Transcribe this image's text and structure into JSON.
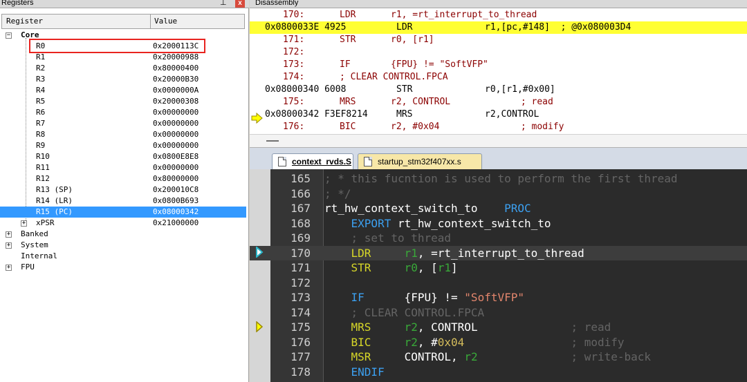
{
  "registers": {
    "title": "Registers",
    "pin_glyph": "⊥",
    "close_glyph": "x",
    "header": {
      "register": "Register",
      "value": "Value"
    },
    "core_label": "Core",
    "rows": [
      {
        "name": "R0",
        "value": "0x2000113C"
      },
      {
        "name": "R1",
        "value": "0x20000988"
      },
      {
        "name": "R2",
        "value": "0x80000400"
      },
      {
        "name": "R3",
        "value": "0x20000B30"
      },
      {
        "name": "R4",
        "value": "0x0000000A"
      },
      {
        "name": "R5",
        "value": "0x20000308"
      },
      {
        "name": "R6",
        "value": "0x00000000"
      },
      {
        "name": "R7",
        "value": "0x00000000"
      },
      {
        "name": "R8",
        "value": "0x00000000"
      },
      {
        "name": "R9",
        "value": "0x00000000"
      },
      {
        "name": "R10",
        "value": "0x0800E8E8"
      },
      {
        "name": "R11",
        "value": "0x00000000"
      },
      {
        "name": "R12",
        "value": "0x80000000"
      },
      {
        "name": "R13 (SP)",
        "value": "0x200010C8"
      },
      {
        "name": "R14 (LR)",
        "value": "0x0800B693"
      },
      {
        "name": "R15 (PC)",
        "value": "0x08000342"
      },
      {
        "name": "xPSR",
        "value": "0x21000000"
      }
    ],
    "groups": [
      "Banked",
      "System",
      "Internal",
      "FPU"
    ]
  },
  "disassembly": {
    "title": "Disassembly",
    "lines": [
      {
        "kind": "src",
        "num": "170:",
        "op": "LDR",
        "args": "r1, =rt_interrupt_to_thread"
      },
      {
        "kind": "cur",
        "addr": "0x0800033E 4925",
        "op": "LDR",
        "args": "r1,[pc,#148]  ; @0x080003D4"
      },
      {
        "kind": "src",
        "num": "171:",
        "op": "STR",
        "args": "r0, [r1]"
      },
      {
        "kind": "src",
        "num": "172:",
        "op": "",
        "args": ""
      },
      {
        "kind": "src",
        "num": "173:",
        "op": "IF",
        "args": "{FPU} != \"SoftVFP\""
      },
      {
        "kind": "src",
        "num": "174:",
        "op": "; CLEAR CONTROL.FPCA",
        "args": ""
      },
      {
        "kind": "asm",
        "addr": "0x08000340 6008",
        "op": "STR",
        "args": "r0,[r1,#0x00]"
      },
      {
        "kind": "src",
        "num": "175:",
        "op": "MRS",
        "args": "r2, CONTROL             ; read"
      },
      {
        "kind": "asm",
        "addr": "0x08000342 F3EF8214",
        "op": "MRS",
        "args": "r2,CONTROL"
      },
      {
        "kind": "src",
        "num": "176:",
        "op": "BIC",
        "args": "r2, #0x04               ; modify"
      }
    ]
  },
  "editor": {
    "tabs": [
      {
        "label": "context_rvds.S",
        "active": true
      },
      {
        "label": "startup_stm32f407xx.s",
        "active": false
      }
    ],
    "lines": [
      {
        "n": "165",
        "cur": false,
        "parts": [
          [
            "c-cm",
            "; * this fucntion is used to perform the first thread"
          ]
        ]
      },
      {
        "n": "166",
        "cur": false,
        "parts": [
          [
            "c-cm",
            "; */"
          ]
        ]
      },
      {
        "n": "167",
        "cur": false,
        "parts": [
          [
            "c-id",
            "rt_hw_context_switch_to"
          ],
          [
            "c-pn",
            "    "
          ],
          [
            "c-dir",
            "PROC"
          ]
        ]
      },
      {
        "n": "168",
        "cur": false,
        "parts": [
          [
            "c-pn",
            "    "
          ],
          [
            "c-dir",
            "EXPORT"
          ],
          [
            "c-id",
            " rt_hw_context_switch_to"
          ]
        ]
      },
      {
        "n": "169",
        "cur": false,
        "parts": [
          [
            "c-pn",
            "    "
          ],
          [
            "c-cm",
            "; set to thread"
          ]
        ]
      },
      {
        "n": "170",
        "cur": true,
        "parts": [
          [
            "c-pn",
            "    "
          ],
          [
            "c-kw",
            "LDR"
          ],
          [
            "c-pn",
            "     "
          ],
          [
            "c-reg",
            "r1"
          ],
          [
            "c-id",
            ", =rt_interrupt_to_thread"
          ]
        ]
      },
      {
        "n": "171",
        "cur": false,
        "parts": [
          [
            "c-pn",
            "    "
          ],
          [
            "c-kw",
            "STR"
          ],
          [
            "c-pn",
            "     "
          ],
          [
            "c-reg",
            "r0"
          ],
          [
            "c-id",
            ", ["
          ],
          [
            "c-reg",
            "r1"
          ],
          [
            "c-id",
            "]"
          ]
        ]
      },
      {
        "n": "172",
        "cur": false,
        "parts": []
      },
      {
        "n": "173",
        "cur": false,
        "parts": [
          [
            "c-pn",
            "    "
          ],
          [
            "c-dir",
            "IF"
          ],
          [
            "c-pn",
            "      "
          ],
          [
            "c-id",
            "{FPU} != "
          ],
          [
            "c-str",
            "\"SoftVFP\""
          ]
        ]
      },
      {
        "n": "174",
        "cur": false,
        "parts": [
          [
            "c-pn",
            "    "
          ],
          [
            "c-cm",
            "; CLEAR CONTROL.FPCA"
          ]
        ]
      },
      {
        "n": "175",
        "cur": false,
        "parts": [
          [
            "c-pn",
            "    "
          ],
          [
            "c-kw",
            "MRS"
          ],
          [
            "c-pn",
            "     "
          ],
          [
            "c-reg",
            "r2"
          ],
          [
            "c-id",
            ", CONTROL"
          ],
          [
            "c-pn",
            "              "
          ],
          [
            "c-cm",
            "; read"
          ]
        ]
      },
      {
        "n": "176",
        "cur": false,
        "parts": [
          [
            "c-pn",
            "    "
          ],
          [
            "c-kw",
            "BIC"
          ],
          [
            "c-pn",
            "     "
          ],
          [
            "c-reg",
            "r2"
          ],
          [
            "c-id",
            ", #"
          ],
          [
            "c-num",
            "0x04"
          ],
          [
            "c-pn",
            "                "
          ],
          [
            "c-cm",
            "; modify"
          ]
        ]
      },
      {
        "n": "177",
        "cur": false,
        "parts": [
          [
            "c-pn",
            "    "
          ],
          [
            "c-kw",
            "MSR"
          ],
          [
            "c-pn",
            "     "
          ],
          [
            "c-id",
            "CONTROL, "
          ],
          [
            "c-reg",
            "r2"
          ],
          [
            "c-pn",
            "              "
          ],
          [
            "c-cm",
            "; write-back"
          ]
        ]
      },
      {
        "n": "178",
        "cur": false,
        "parts": [
          [
            "c-pn",
            "    "
          ],
          [
            "c-dir",
            "ENDIF"
          ]
        ]
      }
    ]
  }
}
